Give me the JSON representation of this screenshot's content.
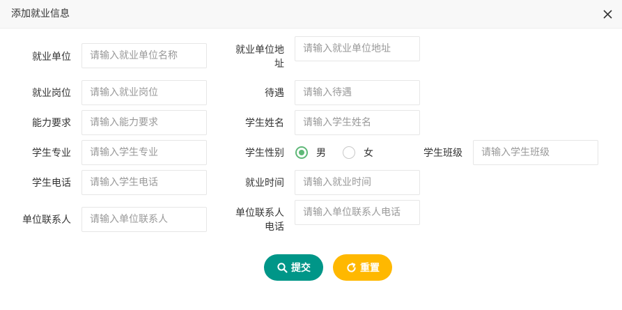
{
  "dialog": {
    "title": "添加就业信息"
  },
  "fields": {
    "employer": {
      "label": "就业单位",
      "placeholder": "请输入就业单位名称"
    },
    "employer_address": {
      "label_line1": "就业单位地",
      "label_line2": "址",
      "placeholder": "请输入就业单位地址"
    },
    "position": {
      "label": "就业岗位",
      "placeholder": "请输入就业岗位"
    },
    "salary": {
      "label": "待遇",
      "placeholder": "请输入待遇"
    },
    "skills": {
      "label": "能力要求",
      "placeholder": "请输入能力要求"
    },
    "student_name": {
      "label": "学生姓名",
      "placeholder": "请输入学生姓名"
    },
    "major": {
      "label": "学生专业",
      "placeholder": "请输入学生专业"
    },
    "gender": {
      "label": "学生性别",
      "options": [
        "男",
        "女"
      ],
      "selected": "男"
    },
    "student_class": {
      "label": "学生班级",
      "placeholder": "请输入学生班级"
    },
    "phone": {
      "label": "学生电话",
      "placeholder": "请输入学生电话"
    },
    "employment_time": {
      "label": "就业时间",
      "placeholder": "请输入就业时间"
    },
    "contact_person": {
      "label": "单位联系人",
      "placeholder": "请输入单位联系人"
    },
    "contact_phone": {
      "label_line1": "单位联系人",
      "label_line2": "电话",
      "placeholder": "请输入单位联系人电话"
    }
  },
  "actions": {
    "submit_label": "提交",
    "reset_label": "重置"
  },
  "colors": {
    "submit": "#009688",
    "reset": "#ffb800",
    "radio_checked": "#5fb878"
  },
  "icons": {
    "close": "close-icon",
    "submit": "search-icon",
    "reset": "refresh-icon"
  }
}
